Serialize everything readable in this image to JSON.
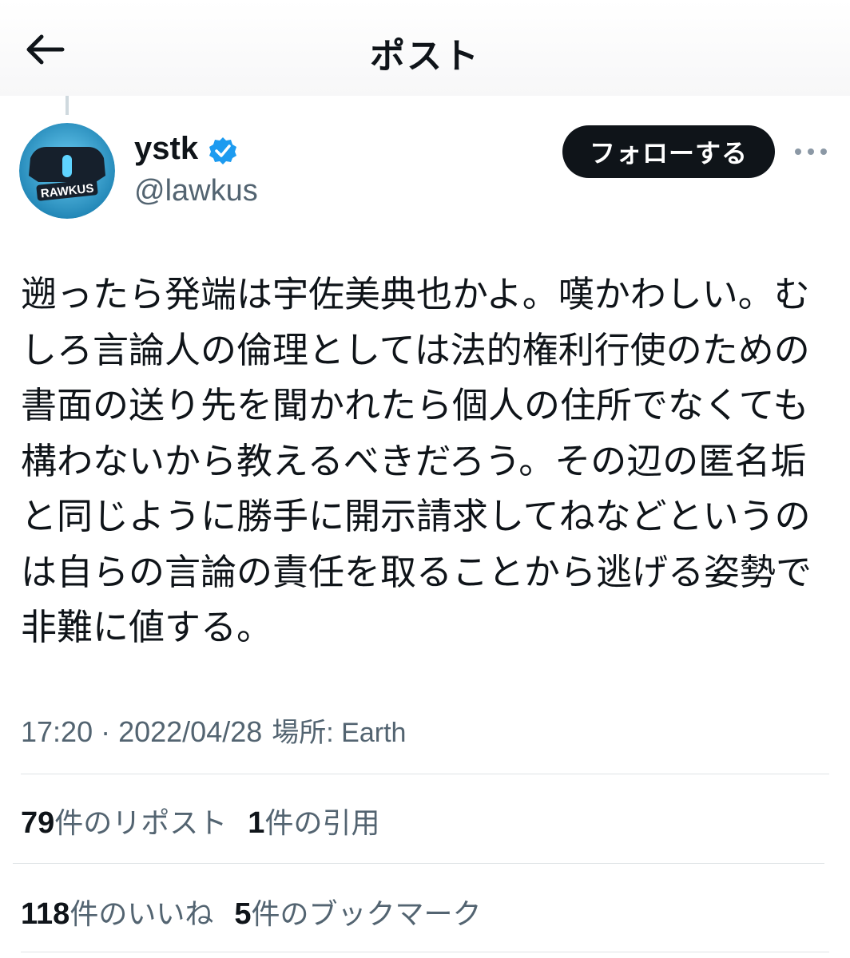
{
  "header": {
    "title": "ポスト"
  },
  "author": {
    "display_name": "ystk",
    "handle": "@lawkus",
    "avatar_text": "RAWKUS",
    "follow_label": "フォローする"
  },
  "post": {
    "text": "遡ったら発端は宇佐美典也かよ。嘆かわしい。むしろ言論人の倫理としては法的権利行使のための書面の送り先を聞かれたら個人の住所でなくても構わないから教えるべきだろう。その辺の匿名垢と同じように勝手に開示請求してねなどというのは自らの言論の責任を取ることから逃げる姿勢で非難に値する。",
    "timestamp": "17:20 · 2022/04/28",
    "location": "場所: Earth"
  },
  "stats": {
    "reposts_count": "79",
    "reposts_label": "件のリポスト",
    "quotes_count": "1",
    "quotes_label": "件の引用",
    "likes_count": "118",
    "likes_label": "件のいいね",
    "bookmarks_count": "5",
    "bookmarks_label": "件のブックマーク"
  },
  "colors": {
    "text": "#0f1419",
    "secondary": "#536471",
    "verified": "#1d9bf0",
    "button": "#0f1419"
  }
}
